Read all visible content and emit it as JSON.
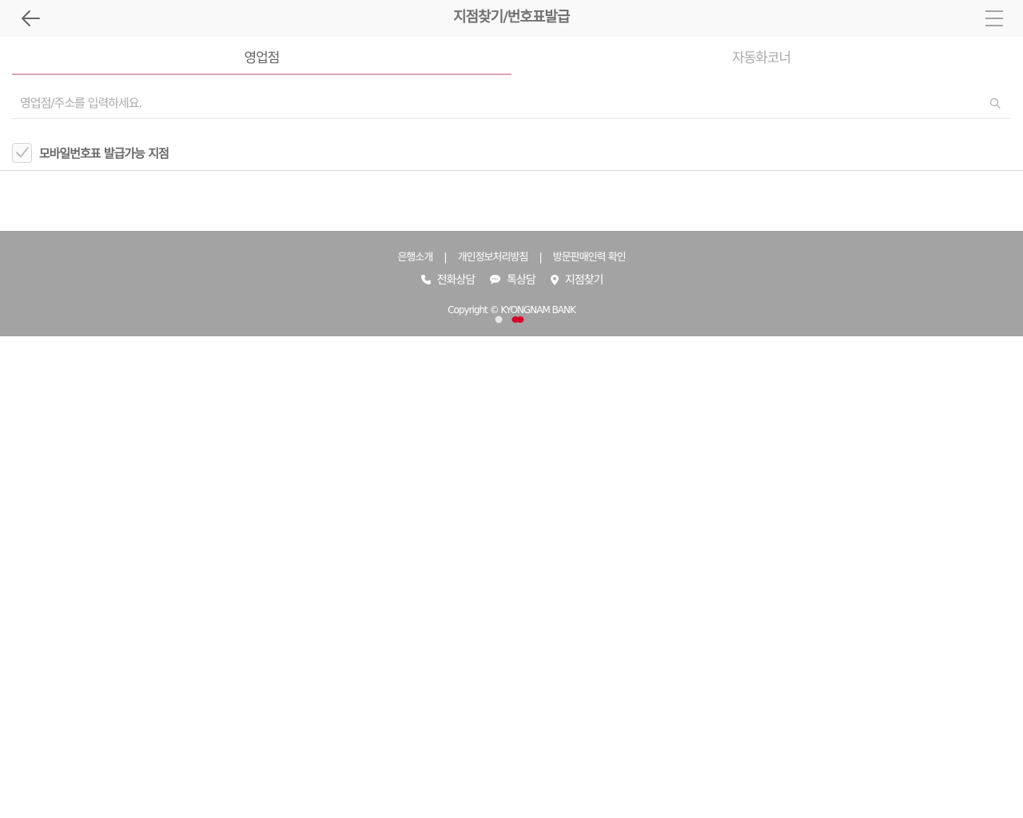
{
  "header": {
    "title": "지점찾기/번호표발급",
    "back_icon": "arrow-left-icon",
    "menu_icon": "hamburger-menu-icon"
  },
  "tabs": [
    {
      "label": "영업점",
      "active": true
    },
    {
      "label": "자동화코너",
      "active": false
    }
  ],
  "search": {
    "placeholder": "영업점/주소를 입력하세요.",
    "value": "",
    "icon": "search-icon"
  },
  "filter": {
    "label": "모바일번호표 발급가능 지점",
    "checked": true
  },
  "footer": {
    "links": [
      "은행소개",
      "개인정보처리방침",
      "방문판매인력 확인"
    ],
    "separator": "|",
    "actions": [
      {
        "label": "전화상담",
        "icon": "phone-icon"
      },
      {
        "label": "톡상담",
        "icon": "chat-bubble-icon"
      },
      {
        "label": "지점찾기",
        "icon": "map-pin-icon"
      }
    ],
    "copyright": "Copyright © KYONGNAM BANK"
  },
  "colors": {
    "footer_bg": "#a3a3a3",
    "active_tab_underline": "#e0a5b5",
    "brand_red": "#d6002a"
  }
}
